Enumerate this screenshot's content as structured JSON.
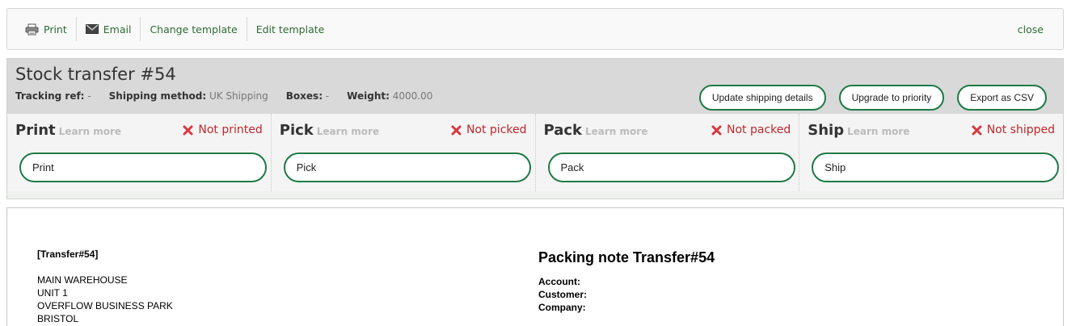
{
  "toolbar": {
    "print_label": "Print",
    "email_label": "Email",
    "change_template_label": "Change template",
    "edit_template_label": "Edit template",
    "close_label": "close"
  },
  "transfer": {
    "title": "Stock transfer #54",
    "tracking_label": "Tracking ref:",
    "tracking_value": "-",
    "shipping_method_label": "Shipping method:",
    "shipping_method_value": "UK Shipping",
    "boxes_label": "Boxes:",
    "boxes_value": "-",
    "weight_label": "Weight:",
    "weight_value": "4000.00"
  },
  "actions": {
    "update_shipping": "Update shipping details",
    "upgrade_priority": "Upgrade to priority",
    "export_csv": "Export as CSV"
  },
  "stages": [
    {
      "name": "Print",
      "learn": "Learn more",
      "status": "Not printed",
      "input": "Print"
    },
    {
      "name": "Pick",
      "learn": "Learn more",
      "status": "Not picked",
      "input": "Pick"
    },
    {
      "name": "Pack",
      "learn": "Learn more",
      "status": "Not packed",
      "input": "Pack"
    },
    {
      "name": "Ship",
      "learn": "Learn more",
      "status": "Not shipped",
      "input": "Ship"
    }
  ],
  "document": {
    "ref": "[Transfer#54]",
    "address": [
      "MAIN WAREHOUSE",
      "UNIT 1",
      "OVERFLOW BUSINESS PARK",
      "BRISTOL"
    ],
    "title": "Packing note Transfer#54",
    "fields": [
      "Account:",
      "Customer:",
      "Company:"
    ]
  },
  "colors": {
    "accent_green": "#1d7a45",
    "link_green": "#2e6b34",
    "status_red": "#c0282b"
  },
  "icons": {
    "print": "printer-icon",
    "email": "envelope-icon",
    "status": "x-mark-icon"
  }
}
